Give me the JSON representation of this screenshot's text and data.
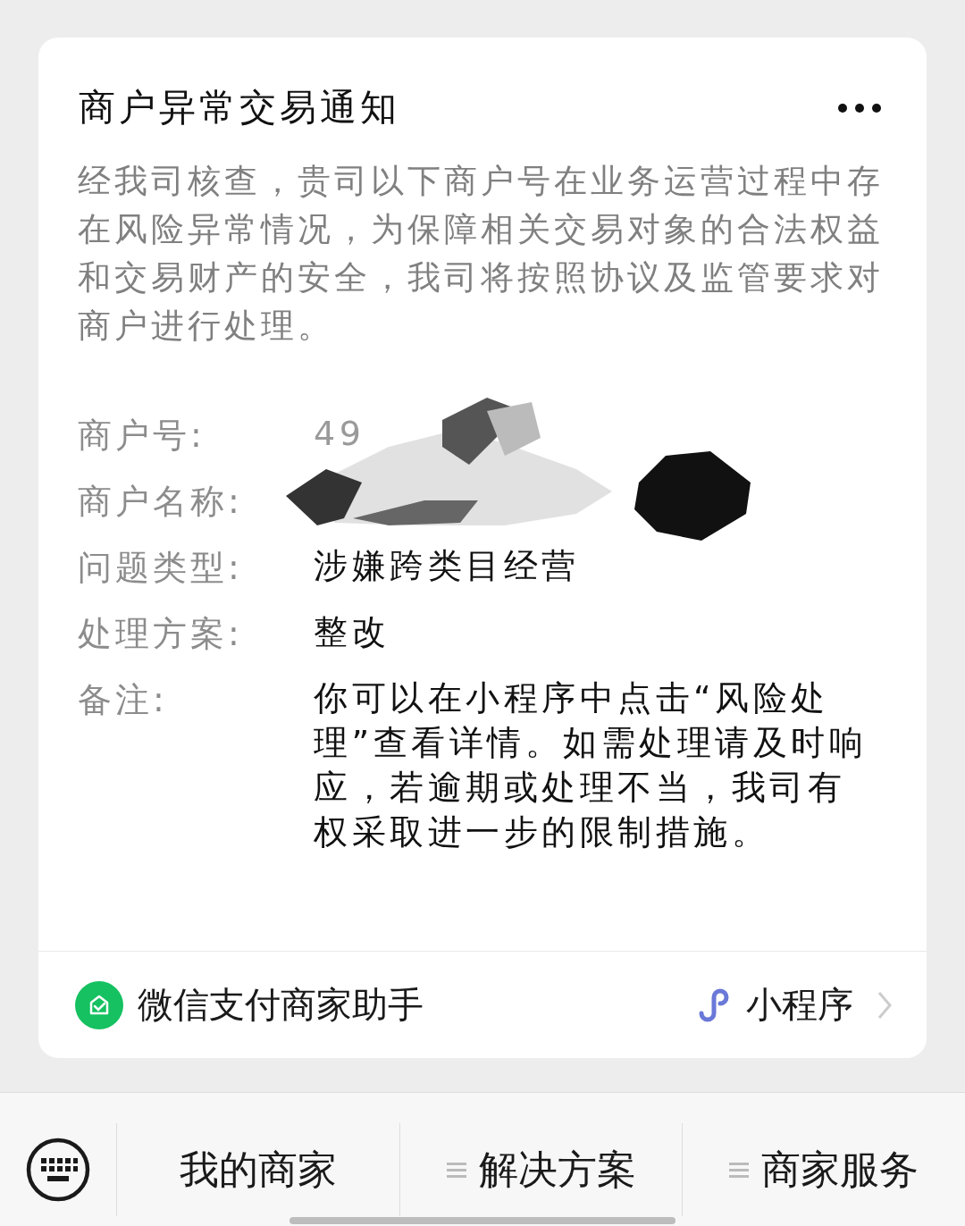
{
  "card": {
    "title": "商户异常交易通知",
    "description": "经我司核查，贵司以下商户号在业务运营过程中存在风险异常情况，为保障相关交易对象的合法权益和交易财产的安全，我司将按照协议及监管要求对商户进行处理。",
    "fields": [
      {
        "label": "商户号:",
        "value": "49"
      },
      {
        "label": "商户名称:"
      },
      {
        "label": "问题类型:",
        "value": "涉嫌跨类目经营"
      },
      {
        "label": "处理方案:",
        "value": "整改"
      },
      {
        "label": "备注:",
        "value": "你可以在小程序中点击“风险处理”查看详情。如需处理请及时响应，若逾期或处理不当，我司有权采取进一步的限制措施。"
      }
    ],
    "source": {
      "name": "微信支付商家助手",
      "type": "小程序"
    }
  },
  "bottom_menu": [
    {
      "label": "我的商家",
      "has_submenu": false
    },
    {
      "label": "解决方案",
      "has_submenu": true
    },
    {
      "label": "商家服务",
      "has_submenu": true
    }
  ]
}
